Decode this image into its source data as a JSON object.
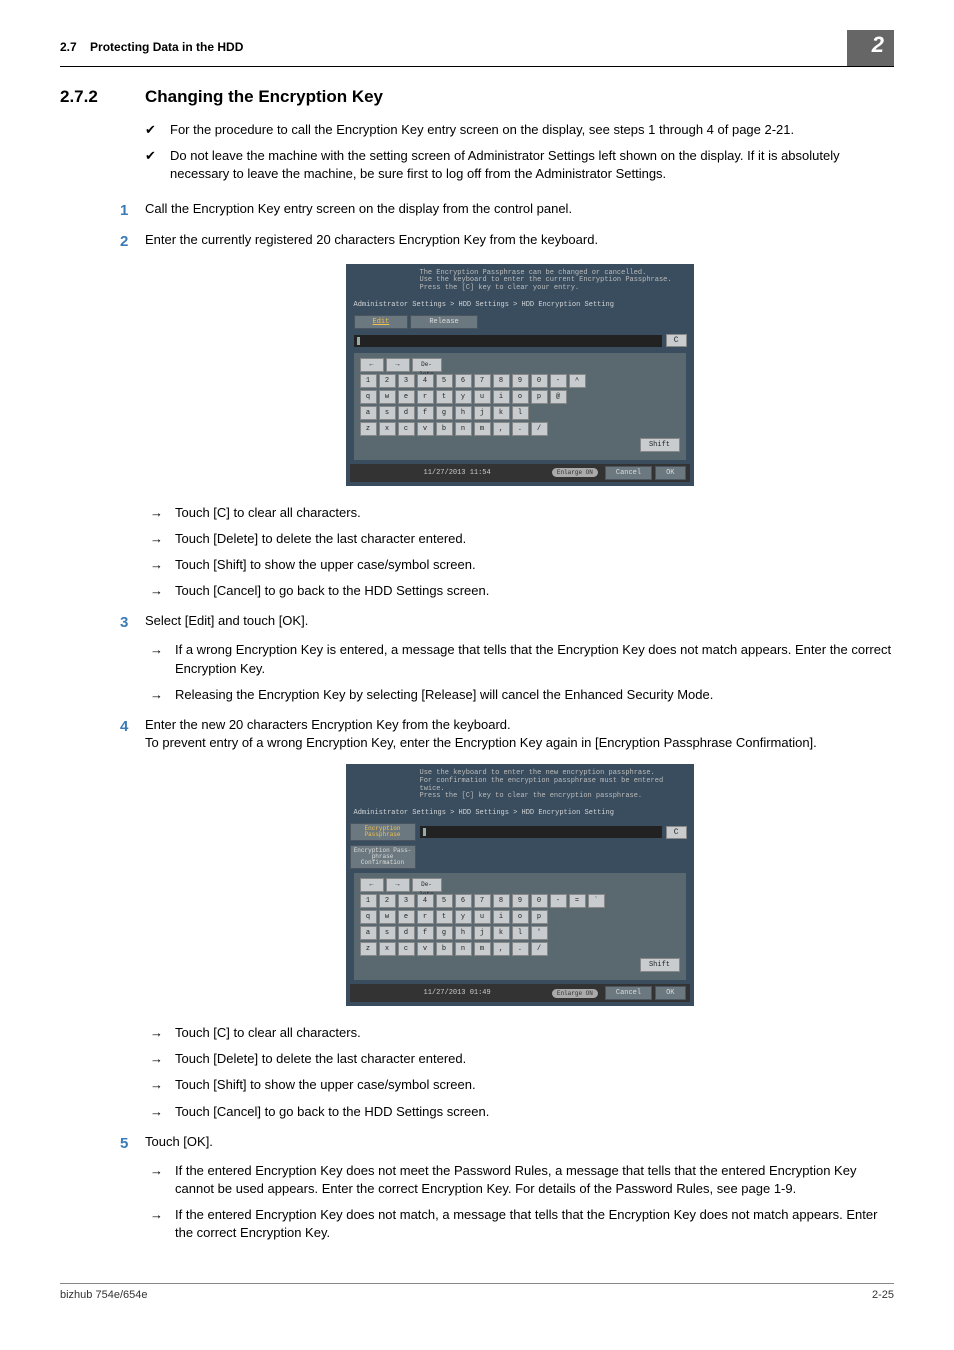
{
  "header": {
    "section_ref": "2.7",
    "section_name": "Protecting Data in the HDD",
    "chapter": "2"
  },
  "title": {
    "number": "2.7.2",
    "text": "Changing the Encryption Key"
  },
  "checks": [
    "For the procedure to call the Encryption Key entry screen on the display, see steps 1 through 4 of page 2-21.",
    "Do not leave the machine with the setting screen of Administrator Settings left shown on the display. If it is absolutely necessary to leave the machine, be sure first to log off from the Administrator Settings."
  ],
  "steps": {
    "s1": {
      "num": "1",
      "text": "Call the Encryption Key entry screen on the display from the control panel."
    },
    "s2": {
      "num": "2",
      "text": "Enter the currently registered 20 characters Encryption Key from the keyboard."
    },
    "s3": {
      "num": "3",
      "text": "Select [Edit] and touch [OK]."
    },
    "s4": {
      "num": "4",
      "text": "Enter the new 20 characters Encryption Key from the keyboard.",
      "text2": "To prevent entry of a wrong Encryption Key, enter the Encryption Key again in [Encryption Passphrase Confirmation]."
    },
    "s5": {
      "num": "5",
      "text": "Touch [OK]."
    }
  },
  "tips_a": [
    "Touch [C] to clear all characters.",
    "Touch [Delete] to delete the last character entered.",
    "Touch [Shift] to show the upper case/symbol screen.",
    "Touch [Cancel] to go back to the HDD Settings screen."
  ],
  "tips_b": [
    "If a wrong Encryption Key is entered, a message that tells that the Encryption Key does not match appears. Enter the correct Encryption Key.",
    "Releasing the Encryption Key by selecting [Release] will cancel the Enhanced Security Mode."
  ],
  "tips_c": [
    "Touch [C] to clear all characters.",
    "Touch [Delete] to delete the last character entered.",
    "Touch [Shift] to show the upper case/symbol screen.",
    "Touch [Cancel] to go back to the HDD Settings screen."
  ],
  "tips_d": [
    "If the entered Encryption Key does not meet the Password Rules, a message that tells that the entered Encryption Key cannot be used appears. Enter the correct Encryption Key. For details of the Password Rules, see page 1-9.",
    "If the entered Encryption Key does not match, a message that tells that the Encryption Key does not match appears. Enter the correct Encryption Key."
  ],
  "screenshot1": {
    "msg1": "The Encryption Passphrase can be changed or cancelled.",
    "msg2": "Use the keyboard to enter the current Encryption Passphrase.",
    "msg3": "Press the [C] key to clear your entry.",
    "breadcrumb": "Administrator Settings > HDD Settings > HDD Encryption Setting",
    "tab_edit": "Edit",
    "tab_release": "Release",
    "clear": "C",
    "delete": "De-\nlete",
    "shift": "Shift",
    "datetime": "11/27/2013   11:54",
    "enlarge": "Enlarge ON",
    "cancel": "Cancel",
    "ok": "OK",
    "rows": {
      "r0a": [
        "←",
        "→"
      ],
      "r1": [
        "1",
        "2",
        "3",
        "4",
        "5",
        "6",
        "7",
        "8",
        "9",
        "0",
        "-",
        "^"
      ],
      "r2": [
        "q",
        "w",
        "e",
        "r",
        "t",
        "y",
        "u",
        "i",
        "o",
        "p",
        "@"
      ],
      "r3": [
        "a",
        "s",
        "d",
        "f",
        "g",
        "h",
        "j",
        "k",
        "l"
      ],
      "r4": [
        "z",
        "x",
        "c",
        "v",
        "b",
        "n",
        "m",
        ",",
        ".",
        "/"
      ]
    }
  },
  "screenshot2": {
    "msg1": "Use the keyboard to enter the new encryption passphrase.",
    "msg2": "For confirmation the encryption passphrase must be entered twice.",
    "msg3": "Press the [C] key to clear the encryption passphrase.",
    "breadcrumb": "Administrator Settings > HDD Settings > HDD Encryption Setting",
    "label1": "Encryption Passphrase",
    "label2": "Encryption Pass- phrase Confirmation",
    "clear": "C",
    "delete": "De-\nlete",
    "shift": "Shift",
    "datetime": "11/27/2013   01:49",
    "enlarge": "Enlarge ON",
    "cancel": "Cancel",
    "ok": "OK",
    "rows": {
      "r0a": [
        "←",
        "→"
      ],
      "r1": [
        "1",
        "2",
        "3",
        "4",
        "5",
        "6",
        "7",
        "8",
        "9",
        "0",
        "-",
        "=",
        "`"
      ],
      "r2": [
        "q",
        "w",
        "e",
        "r",
        "t",
        "y",
        "u",
        "i",
        "o",
        "p"
      ],
      "r3": [
        "a",
        "s",
        "d",
        "f",
        "g",
        "h",
        "j",
        "k",
        "l",
        "'"
      ],
      "r4": [
        "z",
        "x",
        "c",
        "v",
        "b",
        "n",
        "m",
        ",",
        ".",
        "/"
      ]
    }
  },
  "footer": {
    "left": "bizhub 754e/654e",
    "right": "2-25"
  }
}
